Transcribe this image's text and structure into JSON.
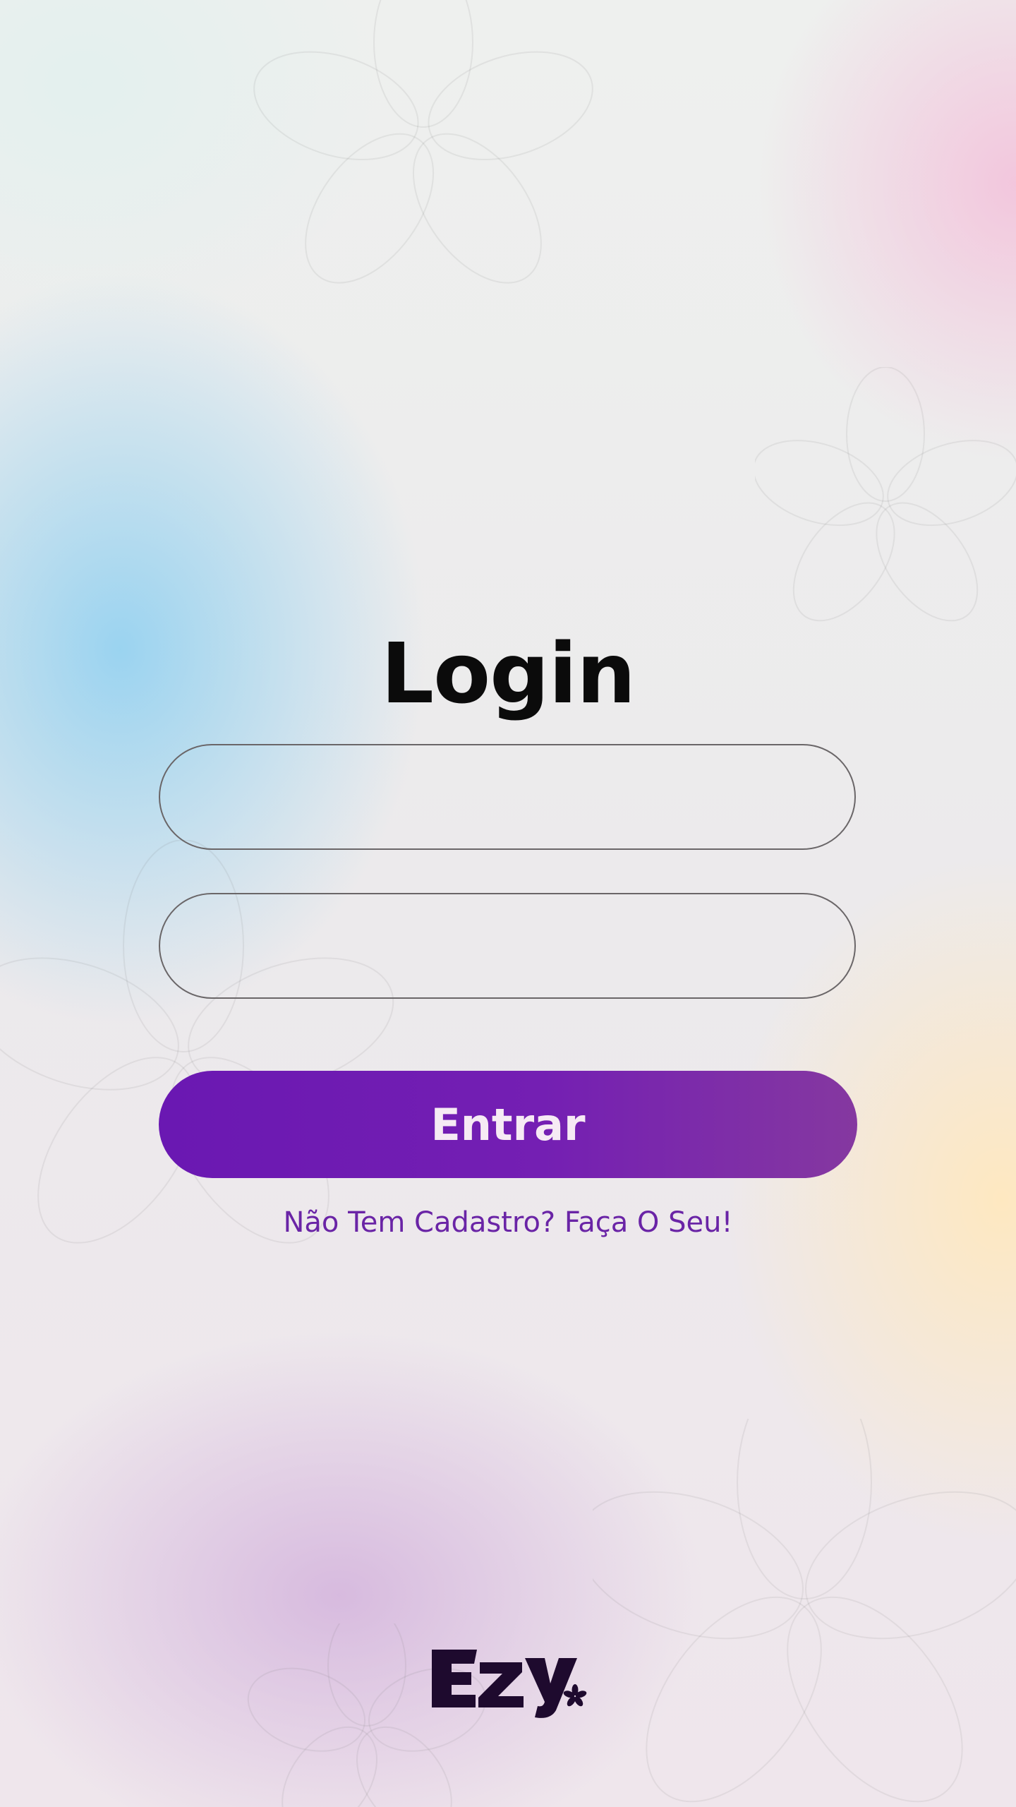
{
  "page": {
    "title": "Login"
  },
  "form": {
    "username": {
      "value": "",
      "placeholder": ""
    },
    "password": {
      "value": "",
      "placeholder": ""
    },
    "submit_label": "Entrar"
  },
  "signup": {
    "link_text": "Não Tem Cadastro? Faça O Seu!"
  },
  "brand": {
    "logo_text": "Ezy",
    "logo_icon": "flower-asterisk-icon"
  },
  "colors": {
    "primary": "#6a18b2",
    "link": "#6a24a6",
    "text": "#0b0b0b",
    "logo": "#1e0a2e"
  }
}
